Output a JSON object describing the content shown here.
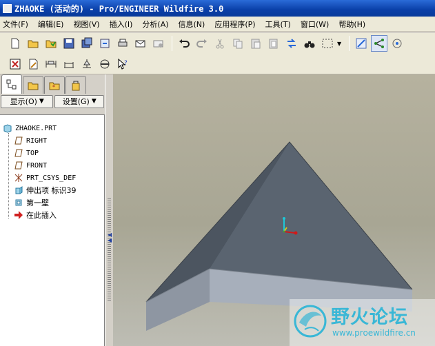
{
  "window": {
    "title": "ZHAOKE (活动的) - Pro/ENGINEER Wildfire 3.0"
  },
  "menu": [
    {
      "label": "文件(F)"
    },
    {
      "label": "编辑(E)"
    },
    {
      "label": "视图(V)"
    },
    {
      "label": "插入(I)"
    },
    {
      "label": "分析(A)"
    },
    {
      "label": "信息(N)"
    },
    {
      "label": "应用程序(P)"
    },
    {
      "label": "工具(T)"
    },
    {
      "label": "窗口(W)"
    },
    {
      "label": "帮助(H)"
    }
  ],
  "panel": {
    "show_label": "显示(O)",
    "settings_label": "设置(G)"
  },
  "tree": {
    "items": [
      {
        "label": "ZHAOKE.PRT",
        "icon": "part-icon"
      },
      {
        "label": "RIGHT",
        "icon": "datum-plane-icon"
      },
      {
        "label": "TOP",
        "icon": "datum-plane-icon"
      },
      {
        "label": "FRONT",
        "icon": "datum-plane-icon"
      },
      {
        "label": "PRT_CSYS_DEF",
        "icon": "csys-icon"
      },
      {
        "label": "伸出项 标识39",
        "icon": "extrude-icon"
      },
      {
        "label": "第一壁",
        "icon": "shell-icon"
      },
      {
        "label": "在此插入",
        "icon": "insert-here-arrow-icon"
      }
    ]
  },
  "watermark": {
    "text": "野火论坛",
    "url": "www.proewildfire.cn"
  },
  "colors": {
    "title_bar": "#0a3fa8",
    "model_face_top": "#5a6470",
    "model_face_side": "#9aa2ae",
    "watermark": "#39b7d6"
  }
}
